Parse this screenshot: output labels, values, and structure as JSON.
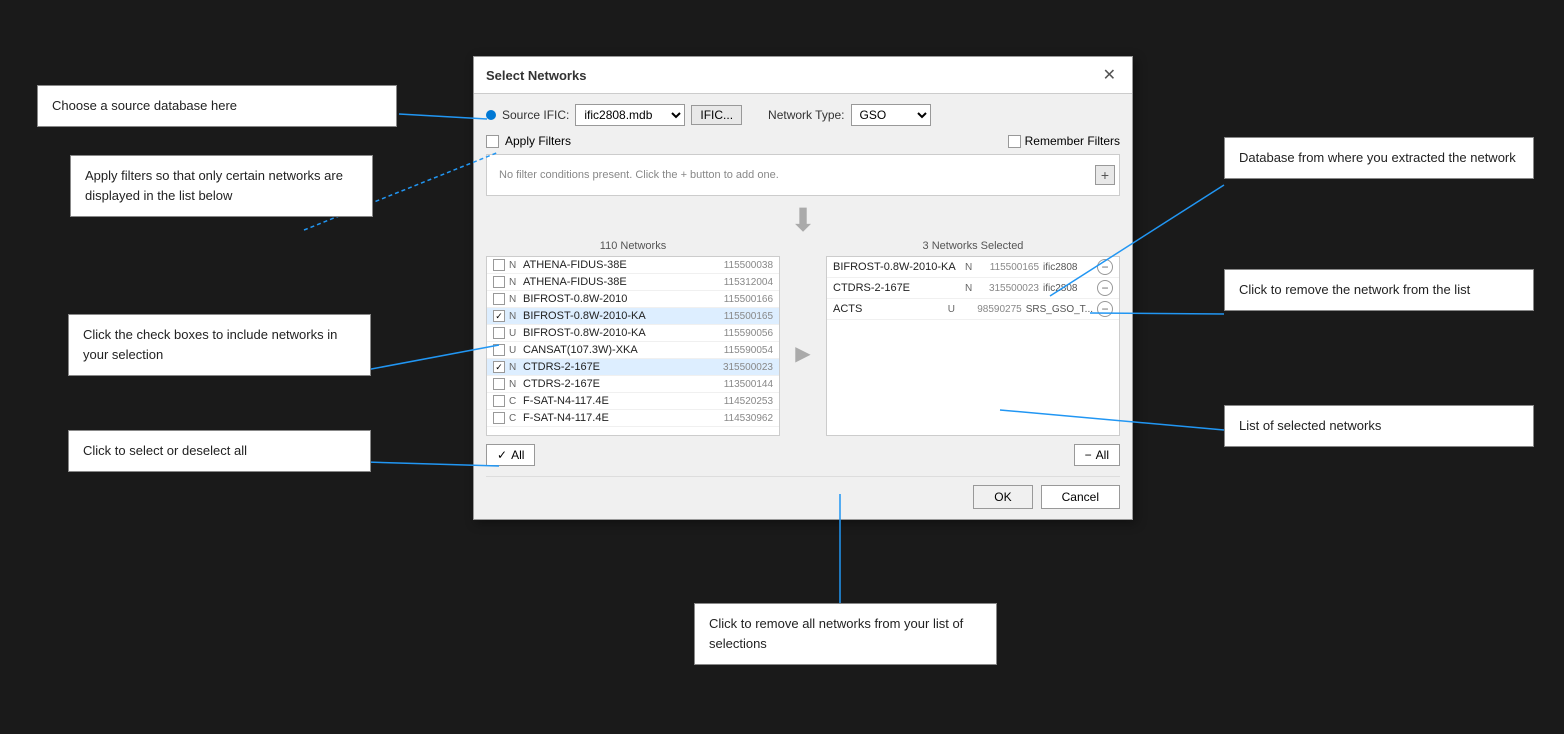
{
  "dialog": {
    "title": "Select Networks",
    "source_label": "Source IFIC:",
    "source_value": "ific2808.mdb",
    "ific_btn": "IFIC...",
    "network_type_label": "Network Type:",
    "network_type_value": "GSO",
    "apply_filters_label": "Apply Filters",
    "remember_filters_label": "Remember Filters",
    "filter_placeholder": "No filter conditions present. Click the + button to add one.",
    "network_count": "110 Networks",
    "selected_count": "3 Networks Selected",
    "all_btn": "All",
    "remove_all_btn": "All",
    "ok_btn": "OK",
    "cancel_btn": "Cancel"
  },
  "networks": [
    {
      "name": "ATHENA-FIDUS-38E",
      "letter": "N",
      "id": "115500038",
      "checked": false
    },
    {
      "name": "ATHENA-FIDUS-38E",
      "letter": "N",
      "id": "115312004",
      "checked": false
    },
    {
      "name": "BIFROST-0.8W-2010",
      "letter": "N",
      "id": "115500166",
      "checked": false
    },
    {
      "name": "BIFROST-0.8W-2010-KA",
      "letter": "N",
      "id": "115500165",
      "checked": true
    },
    {
      "name": "BIFROST-0.8W-2010-KA",
      "letter": "U",
      "id": "115590056",
      "checked": false
    },
    {
      "name": "CANSAT(107.3W)-XKA",
      "letter": "U",
      "id": "115590054",
      "checked": false
    },
    {
      "name": "CTDRS-2-167E",
      "letter": "N",
      "id": "315500023",
      "checked": true
    },
    {
      "name": "CTDRS-2-167E",
      "letter": "N",
      "id": "113500144",
      "checked": false
    },
    {
      "name": "F-SAT-N4-117.4E",
      "letter": "C",
      "id": "114520253",
      "checked": false
    },
    {
      "name": "F-SAT-N4-117.4E",
      "letter": "C",
      "id": "114530962",
      "checked": false
    }
  ],
  "selected_networks": [
    {
      "name": "BIFROST-0.8W-2010-KA",
      "letter": "N",
      "id": "115500165",
      "db": "ific2808"
    },
    {
      "name": "CTDRS-2-167E",
      "letter": "N",
      "id": "315500023",
      "db": "ific2808"
    },
    {
      "name": "ACTS",
      "letter": "U",
      "id": "98590275",
      "db": "SRS_GSO_T..."
    }
  ],
  "annotations": {
    "choose_source": "Choose a source database here",
    "apply_filters": "Apply filters so that only certain networks are displayed in the list below",
    "check_boxes": "Click the check boxes to include networks in your selection",
    "select_deselect": "Click to select or deselect all",
    "database_from": "Database from where you extracted the network",
    "click_remove": "Click to remove the network from the list",
    "remove_all": "Click to remove all networks from your list of selections",
    "list_selected": "List of selected networks"
  }
}
